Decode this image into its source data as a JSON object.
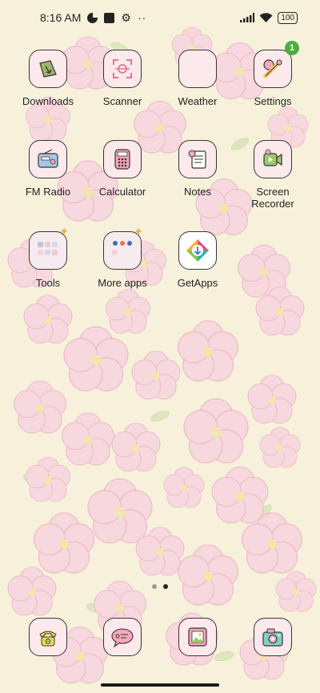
{
  "status_bar": {
    "time": "8:16 AM",
    "battery": "100",
    "overflow": "··"
  },
  "apps": [
    {
      "label": "Downloads",
      "icon": "download-icon",
      "badge": ""
    },
    {
      "label": "Scanner",
      "icon": "scanner-icon",
      "badge": ""
    },
    {
      "label": "Weather",
      "icon": "weather-icon",
      "badge": ""
    },
    {
      "label": "Settings",
      "icon": "settings-icon",
      "badge": "1"
    },
    {
      "label": "FM Radio",
      "icon": "radio-icon",
      "badge": ""
    },
    {
      "label": "Calculator",
      "icon": "calculator-icon",
      "badge": ""
    },
    {
      "label": "Notes",
      "icon": "notes-icon",
      "badge": ""
    },
    {
      "label": "Screen Recorder",
      "icon": "screen-recorder-icon",
      "badge": ""
    },
    {
      "label": "Tools",
      "icon": "folder-icon",
      "badge": ""
    },
    {
      "label": "More apps",
      "icon": "folder-icon",
      "badge": ""
    },
    {
      "label": "GetApps",
      "icon": "getapps-icon",
      "badge": ""
    }
  ],
  "page_indicator": {
    "pages": 2,
    "active": 2
  },
  "dock": [
    {
      "icon": "phone-icon"
    },
    {
      "icon": "messages-icon"
    },
    {
      "icon": "gallery-icon"
    },
    {
      "icon": "camera-icon"
    }
  ],
  "colors": {
    "wallpaper": "#f7f1dc",
    "petal": "#f6d3dc",
    "leaf": "#d7e3b8",
    "icon_bg": "#fbe9ec",
    "badge": "#4cae3c"
  }
}
